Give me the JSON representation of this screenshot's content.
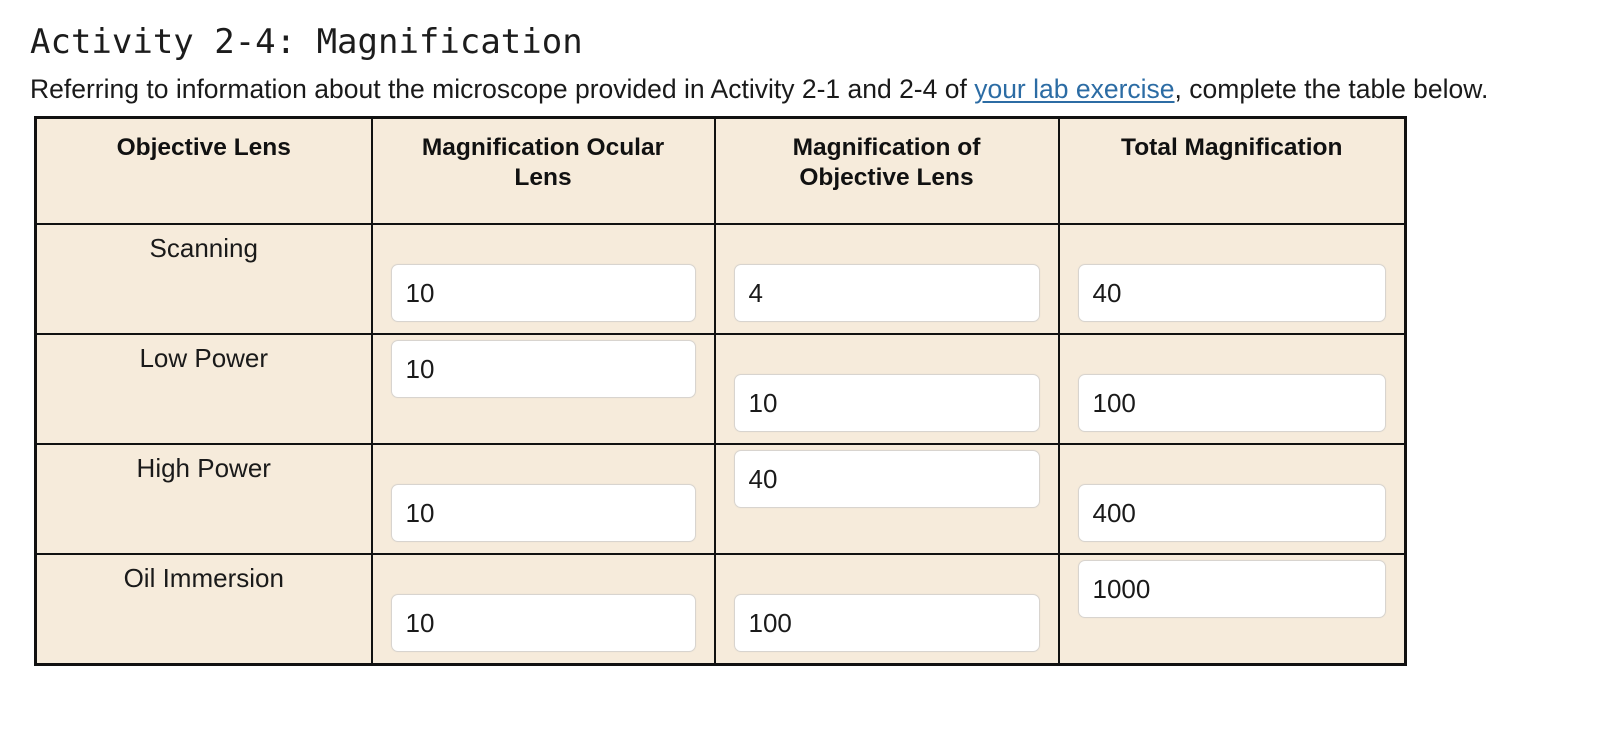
{
  "document": {
    "title": "Activity 2-4: Magnification",
    "intro_before_link": "Referring to information about the microscope provided in Activity 2-1 and 2-4 of ",
    "intro_link": "your lab exercise",
    "intro_after_link": ", complete the table below."
  },
  "table": {
    "headers": [
      "Objective Lens",
      "Magnification Ocular Lens",
      "Magnification of Objective Lens",
      "Total Magnification"
    ],
    "headers_lines": {
      "h1": "Objective Lens",
      "h2_line1": "Magnification Ocular",
      "h2_line2": "Lens",
      "h3_line1": "Magnification of",
      "h3_line2": "Objective Lens",
      "h4": "Total Magnification"
    },
    "rows": [
      {
        "lens": "Scanning",
        "ocular_magnification": "10",
        "objective_magnification": "4",
        "total_magnification": "40"
      },
      {
        "lens": "Low Power",
        "ocular_magnification": "10",
        "objective_magnification": "10",
        "total_magnification": "100"
      },
      {
        "lens": "High Power",
        "ocular_magnification": "10",
        "objective_magnification": "40",
        "total_magnification": "400"
      },
      {
        "lens": "Oil Immersion",
        "ocular_magnification": "10",
        "objective_magnification": "100",
        "total_magnification": "1000"
      }
    ]
  },
  "colors": {
    "cell_background": "#f6ebdb",
    "table_border": "#111111",
    "link": "#2c6ca4",
    "input_background": "#ffffff",
    "input_border": "#d8d4cf",
    "page_background": "#ffffff",
    "text": "#1a1a1a"
  }
}
